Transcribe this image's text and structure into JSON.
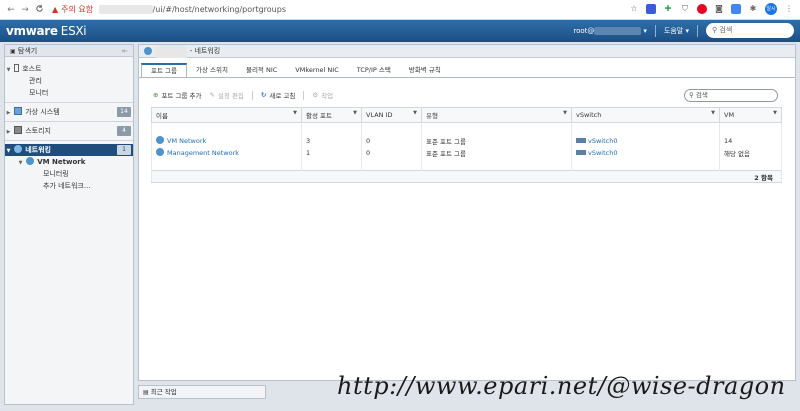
{
  "browser": {
    "back": "←",
    "forward": "→",
    "reload": "C",
    "warning_text": "주의 요함",
    "url_hidden": "192.168.0.10",
    "url_path": "/ui/#/host/networking/portgroups",
    "profile": "일시"
  },
  "header": {
    "logo_main": "vmware",
    "logo_sub": "ESXi",
    "user_prefix": "root@",
    "user_hidden": "192.168.0.10",
    "help": "도움말",
    "search": "검색",
    "brand_color": "#1f5a94"
  },
  "navigator": {
    "title": "탐색기",
    "host": "호스트",
    "manage": "관리",
    "monitor": "모니터",
    "vms": "가상 시스템",
    "vms_count": "14",
    "storage": "스토리지",
    "storage_count": "4",
    "networking": "네트워킹",
    "networking_count": "1",
    "vm_network": "VM Network",
    "vm_network_monitor": "모니터링",
    "more_networks": "추가 네트워크..."
  },
  "main": {
    "title_hidden": "esxi-host",
    "title": "- 네트워킹",
    "tabs": [
      "포트 그룹",
      "가상 스위치",
      "물리적 NIC",
      "VMkernel NIC",
      "TCP/IP 스택",
      "방화벽 규칙"
    ],
    "toolbar": {
      "add": "포트 그룹 추가",
      "edit": "설정 편집",
      "refresh": "새로 고침",
      "actions": "작업"
    },
    "search_placeholder": "검색",
    "columns": [
      "이름",
      "활성 포트",
      "VLAN ID",
      "유형",
      "vSwitch",
      "VM"
    ],
    "rows": [
      {
        "name": "VM Network",
        "ports": "3",
        "vlan": "0",
        "type": "표준 포트 그룹",
        "vswitch": "vSwitch0",
        "vm": "14"
      },
      {
        "name": "Management Network",
        "ports": "1",
        "vlan": "0",
        "type": "표준 포트 그룹",
        "vswitch": "vSwitch0",
        "vm": "해당 없음"
      }
    ],
    "footer": "2 항목"
  },
  "recent_tasks": "최근 작업",
  "watermark": "http://www.epari.net/@wise-dragon"
}
